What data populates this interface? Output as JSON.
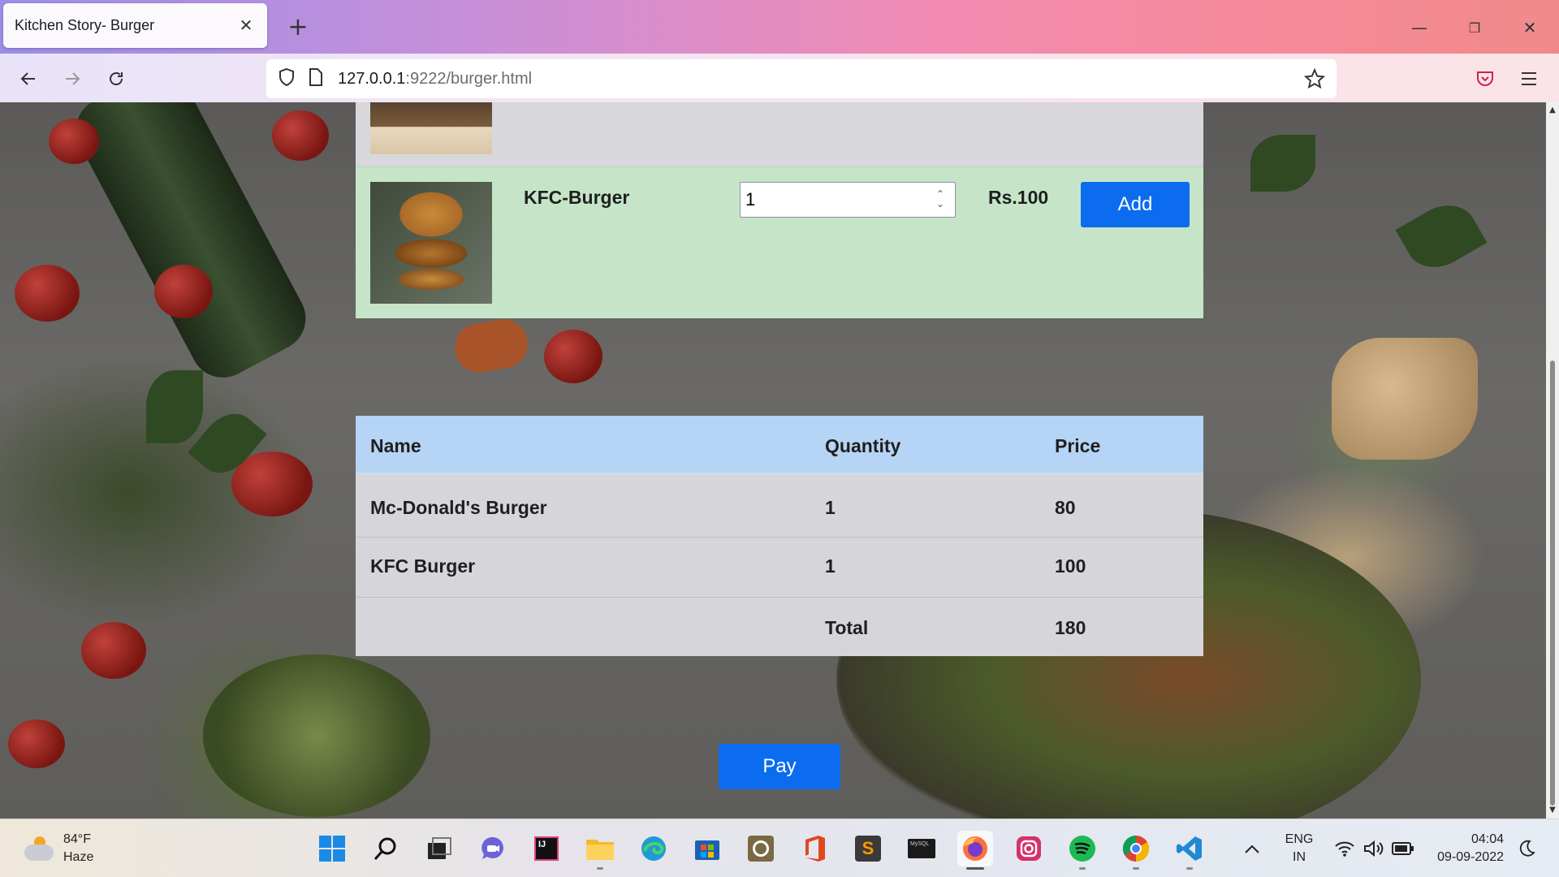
{
  "browser": {
    "tab_title": "Kitchen Story- Burger",
    "url_host": "127.0.0.1",
    "url_path": ":9222/burger.html"
  },
  "menu_items": [
    {
      "name": "KFC-Burger",
      "quantity": "1",
      "price": "Rs.100",
      "add_label": "Add"
    }
  ],
  "cart": {
    "headers": [
      "Name",
      "Quantity",
      "Price"
    ],
    "rows": [
      {
        "name": "Mc-Donald's Burger",
        "quantity": "1",
        "price": "80"
      },
      {
        "name": "KFC Burger",
        "quantity": "1",
        "price": "100"
      }
    ],
    "total_label": "Total",
    "total_value": "180"
  },
  "pay_label": "Pay",
  "taskbar": {
    "weather_temp": "84°F",
    "weather_desc": "Haze",
    "lang_line1": "ENG",
    "lang_line2": "IN",
    "time": "04:04",
    "date": "09-09-2022"
  },
  "colors": {
    "accent_button": "#0b6cf0",
    "item_highlight": "#c6e5c8",
    "table_header": "#b6d4f5"
  },
  "icons": [
    "back-icon",
    "forward-icon",
    "reload-icon",
    "shield-icon",
    "page-icon",
    "star-icon",
    "pocket-icon",
    "menu-icon",
    "windows-start-icon",
    "search-icon",
    "task-view-icon",
    "chat-icon",
    "intellij-icon",
    "file-explorer-icon",
    "edge-icon",
    "store-icon",
    "app-icon",
    "office-icon",
    "sublime-icon",
    "mysql-icon",
    "firefox-icon",
    "instagram-icon",
    "spotify-icon",
    "chrome-icon",
    "vscode-icon",
    "chevron-up-icon",
    "wifi-icon",
    "volume-icon",
    "battery-icon",
    "moon-icon"
  ]
}
